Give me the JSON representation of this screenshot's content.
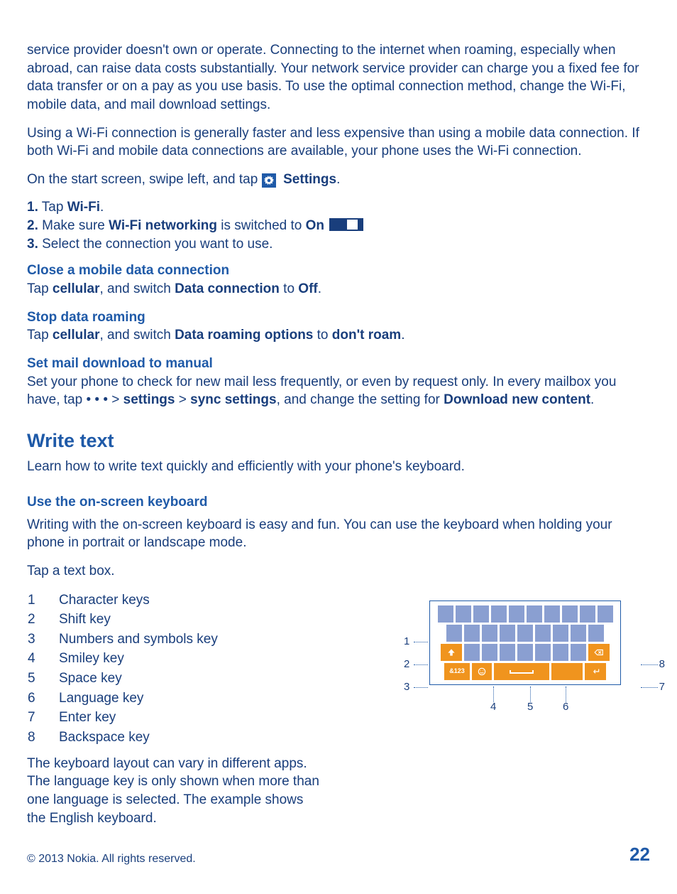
{
  "intro_p1": "service provider doesn't own or operate. Connecting to the internet when roaming, especially when abroad, can raise data costs substantially. Your network service provider can charge you a fixed fee for data transfer or on a pay as you use basis. To use the optimal connection method, change the Wi-Fi, mobile data, and mail download settings.",
  "intro_p2": "Using a Wi-Fi connection is generally faster and less expensive than using a mobile data connection. If both Wi-Fi and mobile data connections are available, your phone uses the Wi-Fi connection.",
  "start_prefix": "On the start screen, swipe left, and tap ",
  "settings_label": "Settings",
  "steps": {
    "s1_num": "1.",
    "s1_a": " Tap ",
    "s1_b": "Wi-Fi",
    "s1_c": ".",
    "s2_num": "2.",
    "s2_a": " Make sure ",
    "s2_b": "Wi-Fi networking",
    "s2_c": " is switched to ",
    "s2_d": "On",
    "s2_e": " ",
    "s2_f": ".",
    "s3_num": "3.",
    "s3_a": " Select the connection you want to use."
  },
  "close_head": "Close a mobile data connection",
  "close_body_a": "Tap ",
  "close_body_b": "cellular",
  "close_body_c": ", and switch ",
  "close_body_d": "Data connection",
  "close_body_e": " to ",
  "close_body_f": "Off",
  "close_body_g": ".",
  "stop_head": "Stop data roaming",
  "stop_a": "Tap ",
  "stop_b": "cellular",
  "stop_c": ", and switch ",
  "stop_d": "Data roaming options",
  "stop_e": " to ",
  "stop_f": "don't roam",
  "stop_g": ".",
  "mail_head": "Set mail download to manual",
  "mail_a": "Set your phone to check for new mail less frequently, or even by request only. In every mailbox you have, tap ",
  "mail_dots": " • • • ",
  "mail_b": " > ",
  "mail_c": "settings",
  "mail_d": " > ",
  "mail_e": "sync settings",
  "mail_f": ", and change the setting for ",
  "mail_g": "Download new content",
  "mail_h": ".",
  "write_heading": "Write text",
  "write_intro": "Learn how to write text quickly and efficiently with your phone's keyboard.",
  "osk_head": "Use the on-screen keyboard",
  "osk_intro": "Writing with the on-screen keyboard is easy and fun. You can use the keyboard when holding your phone in portrait or landscape mode.",
  "osk_tap": "Tap a text box.",
  "legend": [
    {
      "n": "1",
      "t": "Character keys"
    },
    {
      "n": "2",
      "t": "Shift key"
    },
    {
      "n": "3",
      "t": "Numbers and symbols key"
    },
    {
      "n": "4",
      "t": "Smiley key"
    },
    {
      "n": "5",
      "t": "Space key"
    },
    {
      "n": "6",
      "t": "Language key"
    },
    {
      "n": "7",
      "t": "Enter key"
    },
    {
      "n": "8",
      "t": "Backspace key"
    }
  ],
  "osk_note": "The keyboard layout can vary in different apps. The language key is only shown when more than one language is selected. The example shows the English keyboard.",
  "sym_label": "&123",
  "callouts": {
    "c1": "1",
    "c2": "2",
    "c3": "3",
    "c4": "4",
    "c5": "5",
    "c6": "6",
    "c7": "7",
    "c8": "8"
  },
  "footer_copy": "© 2013 Nokia. All rights reserved.",
  "page_num": "22"
}
